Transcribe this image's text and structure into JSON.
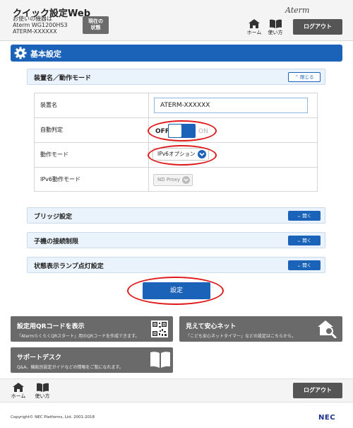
{
  "header": {
    "app_title": "クイック設定Web",
    "model_label": "お使いの機器は",
    "model_name": "Aterm WG1200HS3",
    "device_id": "ATERM-XXXXXX",
    "status_button": [
      "現在の",
      "状態"
    ],
    "brand": "Aterm",
    "home_label": "ホーム",
    "help_label": "使い方",
    "logout_label": "ログアウト"
  },
  "section": {
    "title": "基本設定"
  },
  "panel_main": {
    "label": "装置名／動作モード",
    "toggle_label": "閉じる"
  },
  "settings": {
    "device_name_label": "装置名",
    "device_name_value": "ATERM-XXXXXX",
    "auto_detect_label": "自動判定",
    "auto_detect_off": "OFF",
    "auto_detect_on": "ON",
    "mode_label": "動作モード",
    "mode_value": "IPv6オプション",
    "ipv6_mode_label": "IPv6動作モード",
    "ipv6_mode_value": "ND Proxy"
  },
  "collapsed_panels": [
    {
      "label": "ブリッジ設定",
      "button": "開く"
    },
    {
      "label": "子機の接続制限",
      "button": "開く"
    },
    {
      "label": "状態表示ランプ点灯設定",
      "button": "開く"
    }
  ],
  "submit_label": "設定",
  "cards": {
    "qr": {
      "title": "設定用QRコードを表示",
      "desc": "「AtermらくらくQRスタート」用のQRコードを作成できます。"
    },
    "safe": {
      "title": "見えて安心ネット",
      "desc": "「こども安心ネットタイマー」などの設定はこちらから。"
    },
    "support": {
      "title": "サポートデスク",
      "desc": "Q&A、機能別設定ガイドなどの情報をご覧になれます。"
    }
  },
  "footer": {
    "home_label": "ホーム",
    "help_label": "使い方",
    "logout_label": "ログアウト",
    "copyright": "Copyright© NEC Platforms, Ltd. 2001-2018",
    "logo": "NEC"
  },
  "colors": {
    "primary": "#1b63b8",
    "highlight_ring": "#e01a1a",
    "card": "#6a6a6a"
  }
}
